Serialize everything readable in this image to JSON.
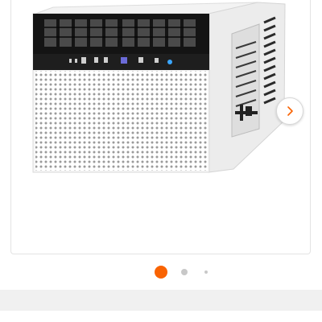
{
  "gallery": {
    "product_image": "window-air-conditioner",
    "next_icon": "chevron-right-icon",
    "accent_color": "#f96302",
    "current_slide": 1,
    "dot_count": 3
  }
}
